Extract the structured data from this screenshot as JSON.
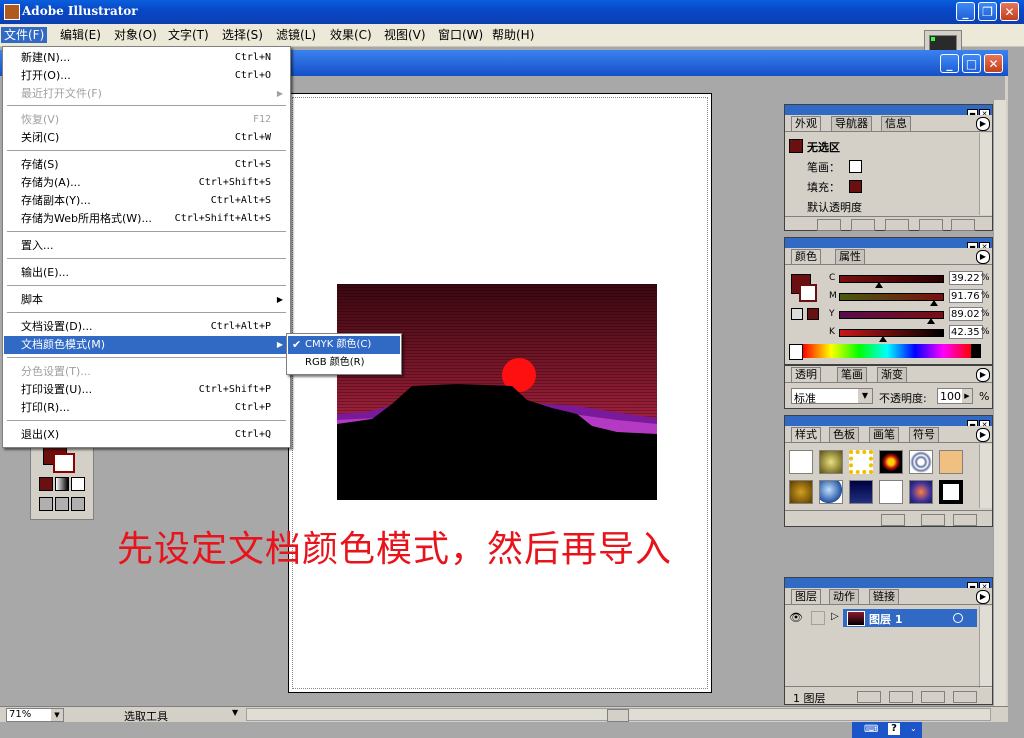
{
  "window": {
    "title": "Adobe Illustrator"
  },
  "menubar": [
    {
      "label": "文件(F)"
    },
    {
      "label": "编辑(E)"
    },
    {
      "label": "对象(O)"
    },
    {
      "label": "文字(T)"
    },
    {
      "label": "选择(S)"
    },
    {
      "label": "滤镜(L)"
    },
    {
      "label": "效果(C)"
    },
    {
      "label": "视图(V)"
    },
    {
      "label": "窗口(W)"
    },
    {
      "label": "帮助(H)"
    }
  ],
  "file_menu": {
    "items": [
      {
        "label": "新建(N)...",
        "shortcut": "Ctrl+N"
      },
      {
        "label": "打开(O)...",
        "shortcut": "Ctrl+O"
      },
      {
        "label": "最近打开文件(F)",
        "shortcut": ""
      },
      {
        "label": "恢复(V)",
        "shortcut": "F12"
      },
      {
        "label": "关闭(C)",
        "shortcut": "Ctrl+W"
      },
      {
        "label": "存储(S)",
        "shortcut": "Ctrl+S"
      },
      {
        "label": "存储为(A)...",
        "shortcut": "Ctrl+Shift+S"
      },
      {
        "label": "存储副本(Y)...",
        "shortcut": "Ctrl+Alt+S"
      },
      {
        "label": "存储为Web所用格式(W)...",
        "shortcut": "Ctrl+Shift+Alt+S"
      },
      {
        "label": "置入...",
        "shortcut": ""
      },
      {
        "label": "输出(E)...",
        "shortcut": ""
      },
      {
        "label": "脚本",
        "shortcut": ""
      },
      {
        "label": "文档设置(D)...",
        "shortcut": "Ctrl+Alt+P"
      },
      {
        "label": "文档颜色模式(M)",
        "shortcut": ""
      },
      {
        "label": "分色设置(T)...",
        "shortcut": ""
      },
      {
        "label": "打印设置(U)...",
        "shortcut": "Ctrl+Shift+P"
      },
      {
        "label": "打印(R)...",
        "shortcut": "Ctrl+P"
      },
      {
        "label": "退出(X)",
        "shortcut": "Ctrl+Q"
      }
    ]
  },
  "color_mode_submenu": [
    {
      "label": "CMYK 颜色(C)",
      "checked": true
    },
    {
      "label": "RGB 颜色(R)",
      "checked": false
    }
  ],
  "caption": "先设定文档颜色模式，然后再导入",
  "appearance_panel": {
    "tabs": [
      "外观",
      "导航器",
      "信息"
    ],
    "no_selection": "无选区",
    "stroke_label": "笔画：",
    "fill_label": "填充：",
    "opacity_label": "默认透明度"
  },
  "color_panel": {
    "tabs": [
      "颜色",
      "属性"
    ],
    "channels": [
      {
        "name": "C",
        "value": "39.22",
        "pct": 39.22
      },
      {
        "name": "M",
        "value": "91.76",
        "pct": 91.76
      },
      {
        "name": "Y",
        "value": "89.02",
        "pct": 89.02
      },
      {
        "name": "K",
        "value": "42.35",
        "pct": 42.35
      }
    ],
    "pct_sign": "%"
  },
  "transparency_panel": {
    "tabs": [
      "透明",
      "笔画",
      "渐变"
    ],
    "blend_mode": "标准",
    "opacity_label": "不透明度:",
    "opacity_value": "100",
    "pct_sign": "%"
  },
  "styles_panel": {
    "tabs": [
      "样式",
      "色板",
      "画笔",
      "符号"
    ]
  },
  "layers_panel": {
    "tabs": [
      "图层",
      "动作",
      "链接"
    ],
    "layer_name": "图层 1",
    "count_label": "1 图层"
  },
  "statusbar": {
    "zoom": "71%",
    "tool": "选取工具"
  },
  "colors": {
    "accent": "#316ac5",
    "fill": "#6b1010",
    "caption": "#e8141c"
  }
}
